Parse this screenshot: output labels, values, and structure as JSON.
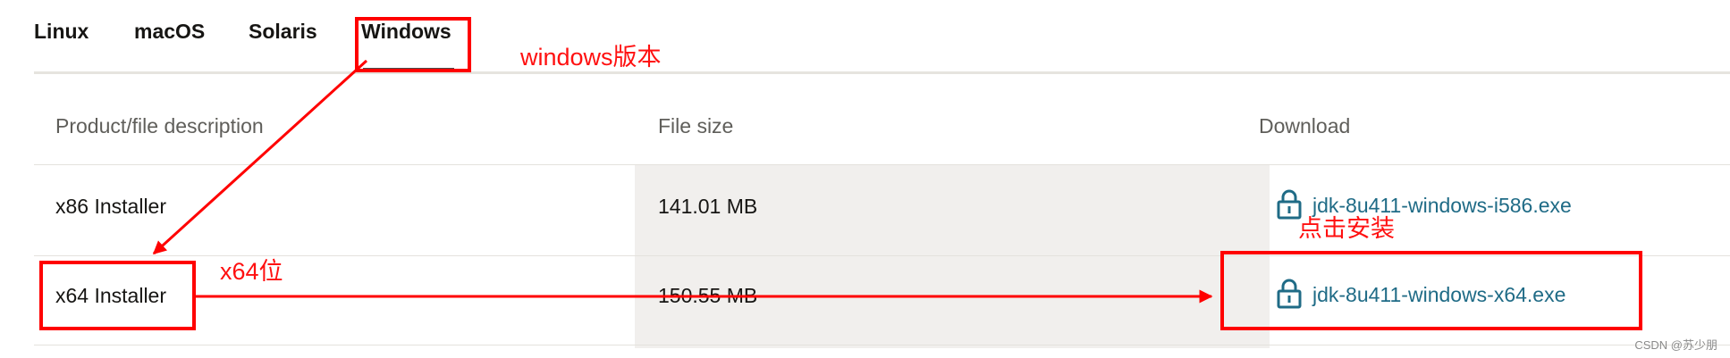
{
  "tabs": [
    {
      "label": "Linux"
    },
    {
      "label": "macOS"
    },
    {
      "label": "Solaris"
    },
    {
      "label": "Windows",
      "active": true
    }
  ],
  "table": {
    "headers": {
      "description": "Product/file description",
      "size": "File size",
      "download": "Download"
    },
    "rows": [
      {
        "description": "x86 Installer",
        "size": "141.01 MB",
        "file": "jdk-8u411-windows-i586.exe"
      },
      {
        "description": "x64 Installer",
        "size": "150.55 MB",
        "file": "jdk-8u411-windows-x64.exe"
      }
    ]
  },
  "annotations": {
    "windows_version": "windows版本",
    "x64_bit": "x64位",
    "click_install": "点击安装"
  },
  "icons": {
    "download_lock": "lock-icon"
  },
  "colors": {
    "link": "#1f6b86",
    "annotation": "#ff0000",
    "text": "#161513",
    "header_text": "#5f5e5a",
    "size_column_bg": "#f1efed"
  },
  "watermark": "CSDN @苏少朋"
}
